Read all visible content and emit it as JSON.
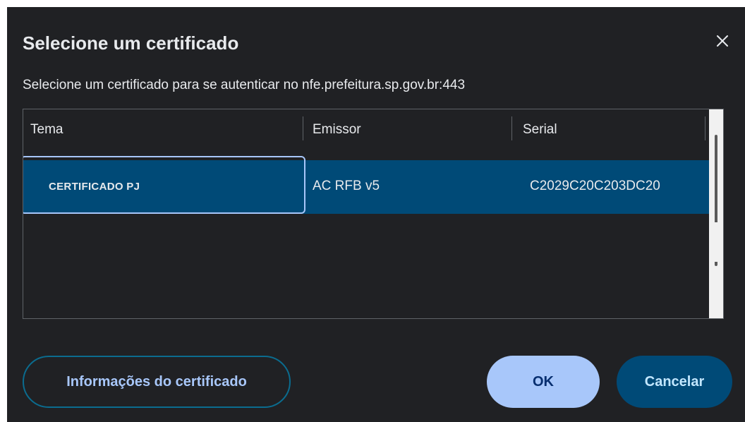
{
  "dialog": {
    "title": "Selecione um certificado",
    "subtitle": "Selecione um certificado para se autenticar no nfe.prefeitura.sp.gov.br:443",
    "close_icon": "close-icon"
  },
  "table": {
    "columns": [
      "Tema",
      "Emissor",
      "Serial"
    ],
    "rows": [
      {
        "tema": "CERTIFICADO PJ",
        "emissor": "AC RFB v5",
        "serial": "C2029C20C203DC20",
        "selected": true
      }
    ]
  },
  "buttons": {
    "info": "Informações do certificado",
    "ok": "OK",
    "cancel": "Cancelar"
  },
  "colors": {
    "background": "#202124",
    "selected_row": "#004a77",
    "primary_button": "#a8c7fa",
    "secondary_button": "#004a77",
    "focus_ring": "#a8c7fa"
  }
}
